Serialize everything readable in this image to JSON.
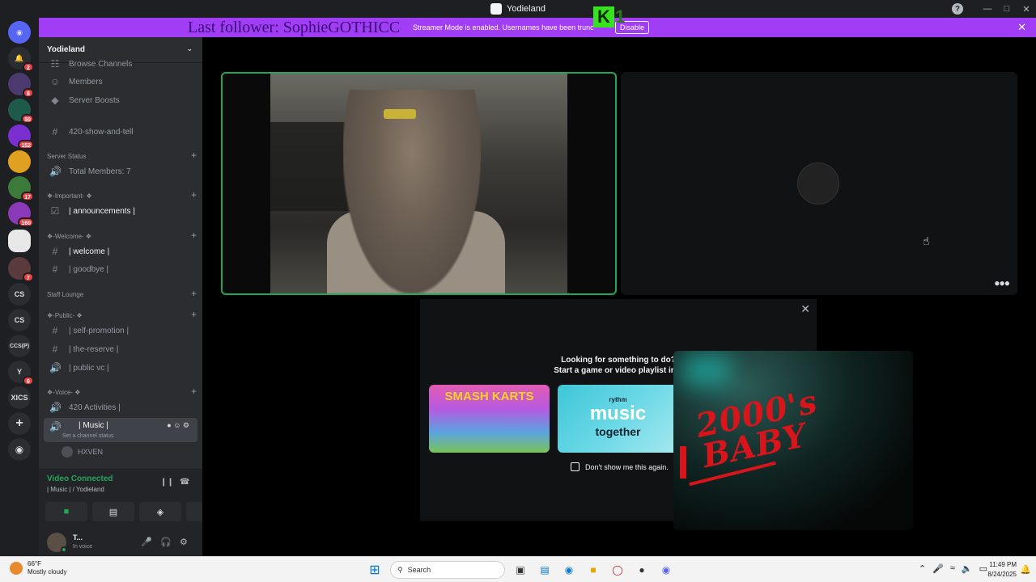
{
  "window": {
    "title": "Yodieland"
  },
  "banner": {
    "follower_text": "Last follower: SophieGOTHICC",
    "streamer_text": "Streamer Mode is enabled. Usernames have been trunc",
    "disable_label": "Disable",
    "accent_color": "#a13ef5"
  },
  "overlay": {
    "k_label": "K",
    "k2_label": "1"
  },
  "guilds": [
    {
      "label": "",
      "badge": "2"
    },
    {
      "label": "",
      "badge": "8"
    },
    {
      "label": "",
      "badge": "50"
    },
    {
      "label": "",
      "badge": "152"
    },
    {
      "label": "",
      "badge": ""
    },
    {
      "label": "",
      "badge": "17"
    },
    {
      "label": "",
      "badge": "160"
    },
    {
      "label": "",
      "badge": ""
    },
    {
      "label": "",
      "badge": "7"
    },
    {
      "label": "CS",
      "badge": ""
    },
    {
      "label": "CS",
      "badge": ""
    },
    {
      "label": "CCS(P)",
      "badge": ""
    },
    {
      "label": "Y",
      "badge": "6"
    },
    {
      "label": "XICS",
      "badge": ""
    }
  ],
  "server": {
    "name": "Yodieland",
    "channels": {
      "browse": "Browse Channels",
      "members": "Members",
      "boosts": "Server Boosts",
      "show_and_tell": "420-show-and-tell",
      "total_members": "Total Members: 7",
      "announcements": "| announcements |",
      "welcome": "| welcome |",
      "goodbye": "| goodbye |",
      "self_promotion": "| self-promotion |",
      "the_reserve": "| the-reserve |",
      "public_vc": "| public vc |",
      "activities": "420 Activities |",
      "music": "| Music |"
    },
    "categories": {
      "server_status": "Server Status",
      "important": "❖-Important- ❖",
      "welcome": "❖-Welcome- ❖",
      "staff": "Staff Lounge",
      "public": "❖-Public- ❖",
      "voice": "❖-Voice- ❖"
    },
    "channel_status_prompt": "Set a channel status",
    "voice_user": "HXVEN"
  },
  "voice_panel": {
    "status": "Video Connected",
    "location": "| Music | / Yodieland"
  },
  "user": {
    "name": "T...",
    "status": "In voice"
  },
  "activity_shelf": {
    "heading_line1": "Looking for something to do?",
    "heading_line2": "Start a game or video playlist inst",
    "card1_label": "SMASH KARTS",
    "card2_small": "rythm",
    "card2_label": "music",
    "card2_label2": "together",
    "dont_show": "Don't show me this again."
  },
  "popout": {
    "title": "2000's BABY"
  },
  "taskbar": {
    "temperature": "66°F",
    "weather": "Mostly cloudy",
    "search_placeholder": "Search",
    "time": "11:49 PM",
    "date": "8/24/2025"
  }
}
